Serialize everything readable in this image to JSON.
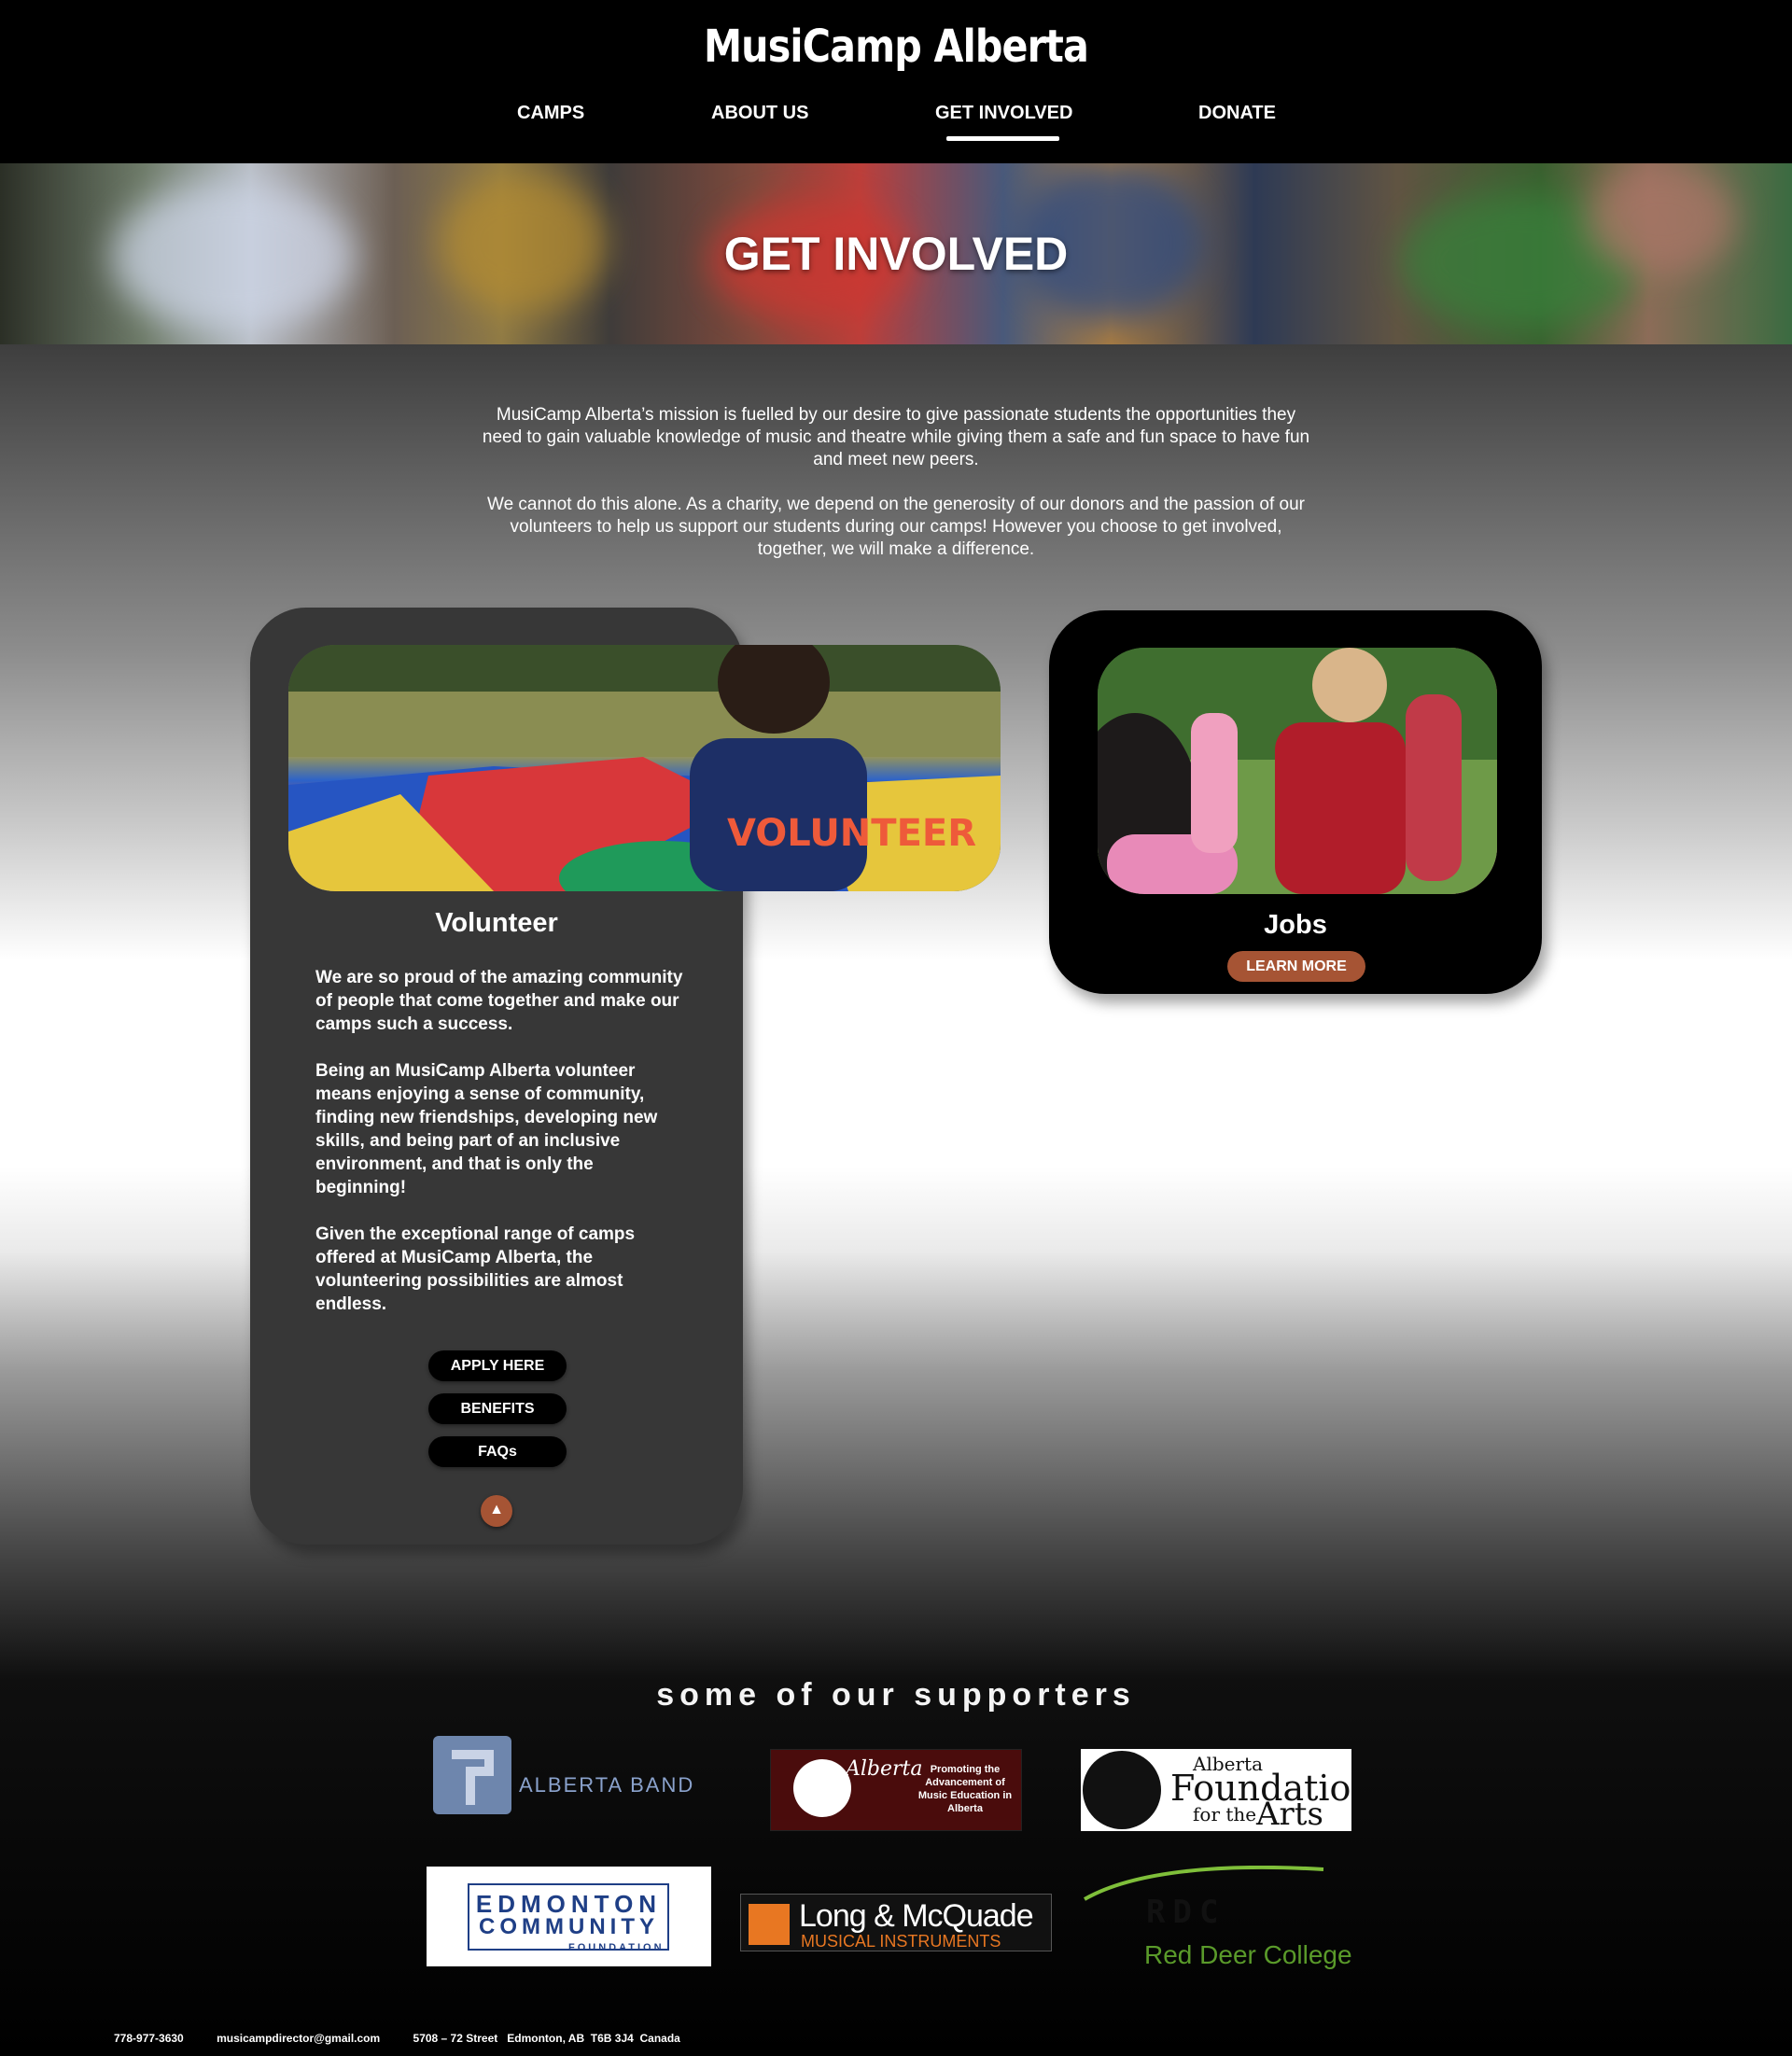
{
  "brand": "MusiCamp Alberta",
  "nav": [
    {
      "label": "CAMPS"
    },
    {
      "label": "ABOUT US"
    },
    {
      "label": "GET INVOLVED"
    },
    {
      "label": "DONATE"
    }
  ],
  "hero": {
    "title": "GET INVOLVED"
  },
  "intro": [
    "MusiCamp Alberta’s mission is fuelled by our desire to give passionate students the opportunities they need to gain valuable knowledge of music and theatre while giving them a safe and fun space to have fun and meet new peers.",
    "We cannot do this alone. As a charity, we depend on the generosity of our donors and the passion of our volunteers to help us support our students during our camps! However you choose to get involved, together, we will make a difference."
  ],
  "volunteer": {
    "title": "Volunteer",
    "photo_text": "VOLUNTEER",
    "paragraphs": [
      "We are so proud of the amazing community of people that come together and make our camps such a success.",
      "Being an MusiCamp Alberta volunteer means enjoying a sense of community, finding new friendships, developing new skills, and being part of an inclusive environment, and that is only the beginning!",
      "Given the exceptional range of camps offered at MusiCamp Alberta, the volunteering possibilities are almost endless."
    ],
    "buttons": {
      "apply": "APPLY HERE",
      "benefits": "BENEFITS",
      "faqs": "FAQs"
    }
  },
  "jobs": {
    "title": "Jobs",
    "button": "LEARN MORE"
  },
  "supporters": {
    "title": "some of our supporters",
    "logos": {
      "alberta_band": "ALBERTA BAND",
      "music_foundation_side": "Promoting the Advancement of Music Education in Alberta",
      "music_foundation_name": "Alberta",
      "afa_line1": "Alberta",
      "afa_line2": "Foundation",
      "afa_line3a": "for the",
      "afa_line3b": "Arts",
      "ecf_line1": "EDMONTON",
      "ecf_line2": "COMMUNITY",
      "ecf_line3": "FOUNDATION",
      "lm_line1": "Long & McQuade",
      "lm_line2": "MUSICAL INSTRUMENTS",
      "rdc_mark": "RDC",
      "rdc_name": "Red Deer College"
    }
  },
  "footer": {
    "phone": "778-977-3630",
    "email": "musicampdirector@gmail.com",
    "address": "5708 – 72 Street   Edmonton, AB  T6B 3J4  Canada"
  },
  "colors": {
    "accent": "#a65434",
    "card_dark": "#373737"
  }
}
